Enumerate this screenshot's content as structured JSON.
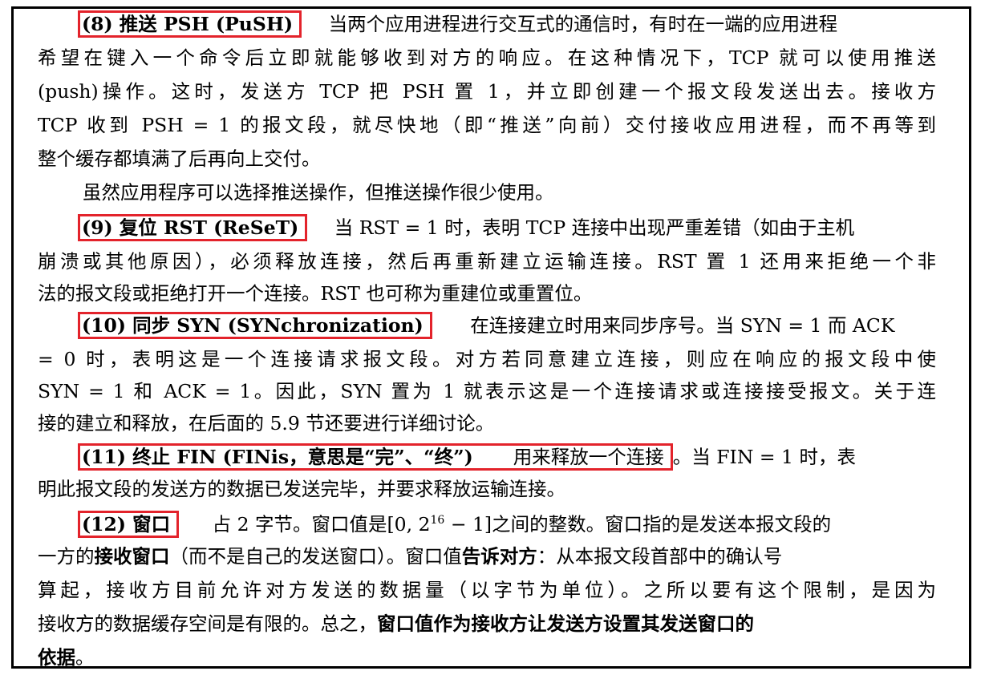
{
  "paragraphs": {
    "psh": {
      "label": "(8) 推送 PSH (PuSH)",
      "line1": "当两个应用进程进行交互式的通信时，有时在一端的应用进程",
      "line2": "希望在键入一个命令后立即就能够收到对方的响应。在这种情况下，TCP 就可以使用推送",
      "line3": "(push)操作。这时，发送方 TCP 把 PSH 置 1，并立即创建一个报文段发送出去。接收方",
      "line4": "TCP 收到 PSH = 1 的报文段，就尽快地（即“推送”向前）交付接收应用进程，而不再等到",
      "line5": "整个缓存都填满了后再向上交付。",
      "line6": "虽然应用程序可以选择推送操作，但推送操作很少使用。"
    },
    "rst": {
      "label": "(9) 复位 RST (ReSeT)",
      "line1": "当 RST = 1 时，表明 TCP 连接中出现严重差错（如由于主机",
      "line2": "崩溃或其他原因），必须释放连接，然后再重新建立运输连接。RST 置 1 还用来拒绝一个非",
      "line3": "法的报文段或拒绝打开一个连接。RST 也可称为重建位或重置位。"
    },
    "syn": {
      "label": "(10) 同步 SYN (SYNchronization)",
      "line1": "在连接建立时用来同步序号。当 SYN = 1 而 ACK",
      "line2": "= 0 时，表明这是一个连接请求报文段。对方若同意建立连接，则应在响应的报文段中使",
      "line3": "SYN = 1 和 ACK = 1。因此，SYN 置为 1 就表示这是一个连接请求或连接接受报文。关于连",
      "line4": "接的建立和释放，在后面的 5.9 节还要进行详细讨论。"
    },
    "fin": {
      "label": "(11) 终止 FIN (FINis，意思是“完”、“终”)",
      "label_tail": "用来释放一个连接",
      "line1_rest": "。当 FIN = 1 时，表",
      "line2": "明此报文段的发送方的数据已发送完毕，并要求释放运输连接。"
    },
    "window": {
      "label": "(12) 窗口",
      "line1_a": "占 2 字节。窗口值是[0, 2",
      "line1_sup": "16",
      "line1_b": " − 1]之间的整数。窗口指的是发送本报文段的",
      "line2_a": "一方的",
      "line2_bold1": "接收窗口",
      "line2_b": "（而不是自己的发送窗口）。窗口值",
      "line2_bold2": "告诉对方",
      "line2_c": "：从本报文段首部中的确认号",
      "line3": "算起，接收方目前允许对方发送的数据量（以字节为单位）。之所以要有这个限制，是因为",
      "line4_a": "接收方的数据缓存空间是有限的。总之，",
      "line4_bold": "窗口值作为接收方让发送方设置其发送窗口的",
      "line5_bold": "依据",
      "line5_end": "。"
    }
  },
  "colors": {
    "highlight_border": "#e3232b",
    "frame_border": "#000000"
  }
}
